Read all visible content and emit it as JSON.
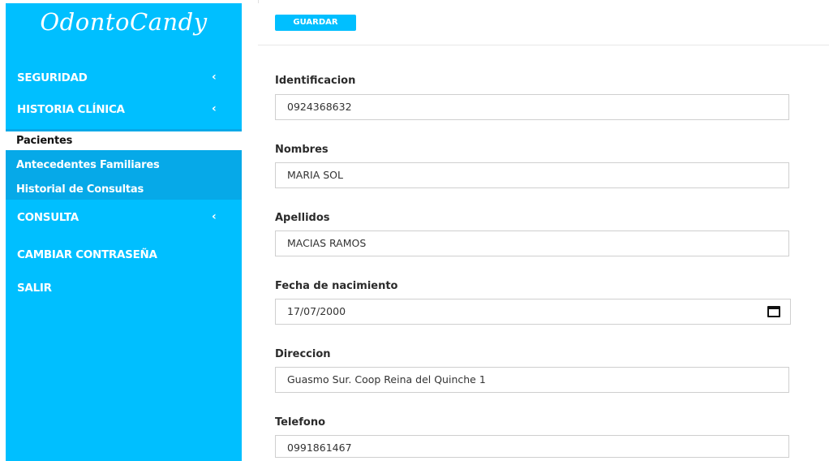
{
  "app": {
    "logo_text": "OdontoCandy"
  },
  "sidebar": {
    "items": [
      {
        "label": "SEGURIDAD",
        "chevron": "chevron-left-icon"
      },
      {
        "label": "HISTORIA CLÍNICA",
        "chevron": "chevron-left-icon"
      },
      {
        "label": "CONSULTA",
        "chevron": "chevron-left-icon"
      },
      {
        "label": "CAMBIAR CONTRASEÑA"
      },
      {
        "label": "SALIR"
      }
    ],
    "submenu": [
      {
        "label": "Pacientes",
        "active": true
      },
      {
        "label": "Antecedentes Familiares"
      },
      {
        "label": "Historial de Consultas"
      }
    ],
    "chevron_glyph": "‹"
  },
  "toolbar": {
    "save_label": "GUARDAR"
  },
  "form": {
    "identificacion": {
      "label": "Identificacion",
      "value": "0924368632"
    },
    "nombres": {
      "label": "Nombres",
      "value": "MARIA SOL"
    },
    "apellidos": {
      "label": "Apellidos",
      "value": "MACIAS RAMOS"
    },
    "fecha": {
      "label": "Fecha de nacimiento",
      "value": "17/07/2000",
      "icon": "calendar-icon"
    },
    "direccion": {
      "label": "Direccion",
      "value": "Guasmo Sur. Coop Reina del Quinche 1"
    },
    "telefono": {
      "label": "Telefono",
      "value": "0991861467"
    }
  },
  "colors": {
    "accent": "#00bfff",
    "submenu_bg": "#06a9e8"
  }
}
